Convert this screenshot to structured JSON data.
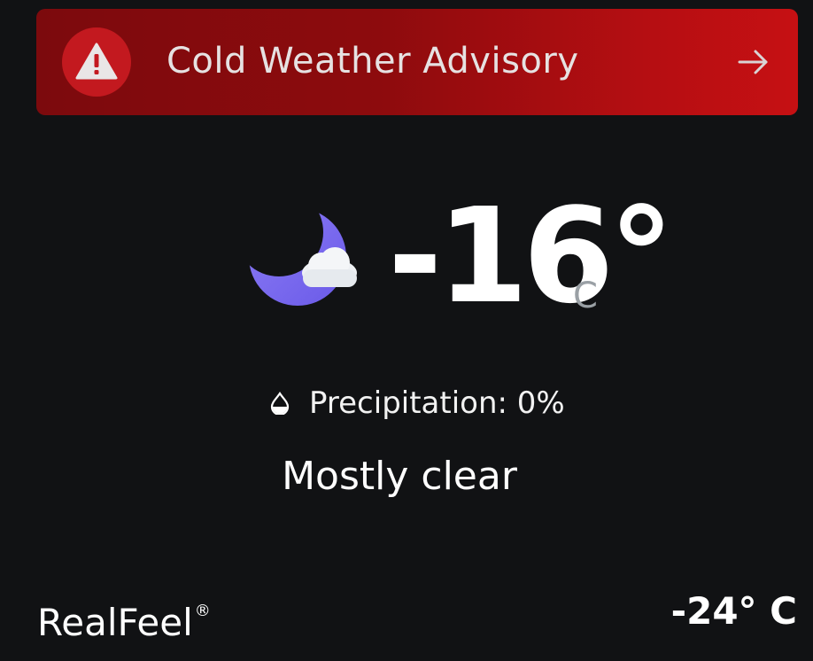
{
  "advisory": {
    "title": "Cold Weather Advisory",
    "icon": "warning-triangle-icon",
    "action_icon": "arrow-right-icon",
    "background_color": "#8d0b0d",
    "icon_circle_color": "#c3191f"
  },
  "current": {
    "icon": "moon-cloud-icon",
    "temperature": "-16°",
    "unit": "C",
    "precipitation_icon": "water-drop-icon",
    "precipitation_text": "Precipitation: 0%",
    "condition": "Mostly clear"
  },
  "realfeel": {
    "label": "RealFeel",
    "trademark": "®",
    "value": "-24° C"
  },
  "colors": {
    "background": "#111214",
    "moon": "#7b6bf0",
    "unit_text": "#9aa0a5"
  }
}
